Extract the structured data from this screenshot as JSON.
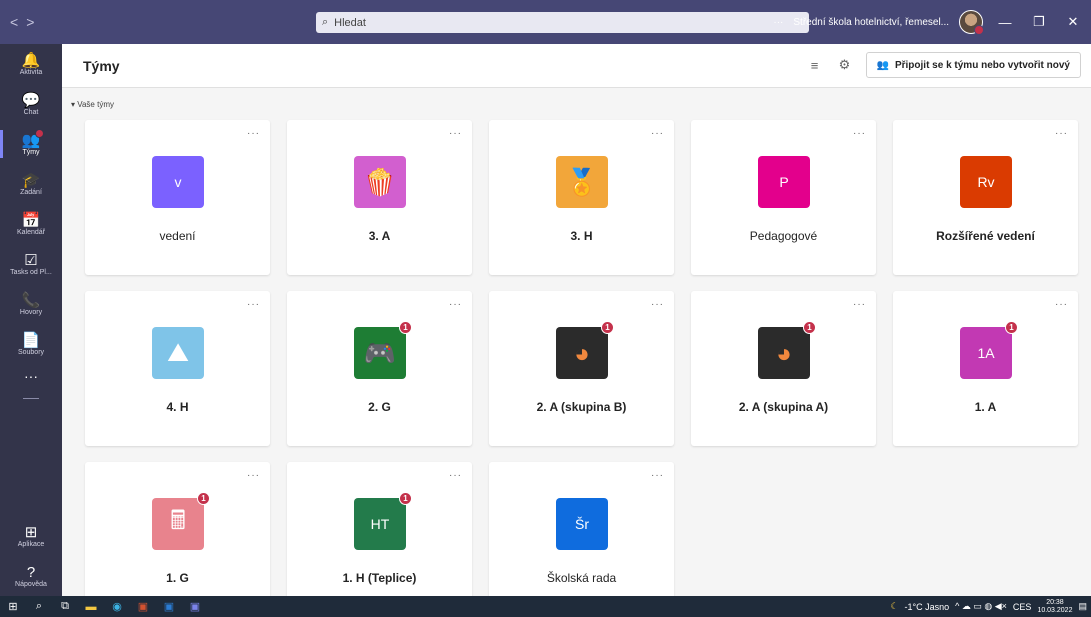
{
  "titlebar": {
    "search_placeholder": "Hledat",
    "more": "···",
    "org_name": "Střední škola hotelnictví, řemesel...",
    "minimize": "—",
    "restore": "❐",
    "close": "✕"
  },
  "rail": {
    "items": [
      {
        "label": "Aktivita",
        "icon": "bell-icon",
        "glyph": "🔔"
      },
      {
        "label": "Chat",
        "icon": "chat-icon",
        "glyph": "💬"
      },
      {
        "label": "Týmy",
        "icon": "teams-icon",
        "glyph": "👥",
        "active": true
      },
      {
        "label": "Zadání",
        "icon": "assignments-icon",
        "glyph": "🎓"
      },
      {
        "label": "Kalendář",
        "icon": "calendar-icon",
        "glyph": "📅"
      },
      {
        "label": "Tasks od Pl...",
        "icon": "tasks-icon",
        "glyph": "☑"
      },
      {
        "label": "Hovory",
        "icon": "phone-icon",
        "glyph": "📞"
      },
      {
        "label": "Soubory",
        "icon": "file-icon",
        "glyph": "📄"
      }
    ],
    "more": "···",
    "bottom": [
      {
        "label": "Aplikace",
        "icon": "apps-icon",
        "glyph": "⊞"
      },
      {
        "label": "Nápověda",
        "icon": "help-icon",
        "glyph": "?"
      }
    ]
  },
  "header": {
    "title": "Týmy",
    "join_label": "Připojit se k týmu nebo vytvořit nový"
  },
  "section": {
    "label": "▾ Vaše týmy"
  },
  "teams": [
    {
      "name": "vedení",
      "tile_text": "v",
      "tile_color": "#7b61ff",
      "bold": false,
      "badge": ""
    },
    {
      "name": "3. A",
      "tile_text": "",
      "tile_color": "#d25fcf",
      "icon": "popcorn-icon",
      "bold": true,
      "badge": ""
    },
    {
      "name": "3. H",
      "tile_text": "",
      "tile_color": "#f2a63a",
      "icon": "medal-icon",
      "bold": true,
      "badge": ""
    },
    {
      "name": "Pedagogové",
      "tile_text": "P",
      "tile_color": "#e3008c",
      "bold": false,
      "badge": ""
    },
    {
      "name": "Rozšířené vedení",
      "tile_text": "Rv",
      "tile_color": "#da3b01",
      "bold": true,
      "badge": ""
    },
    {
      "name": "4. H",
      "tile_text": "",
      "tile_color": "#7fc4e8",
      "icon": "mountain-icon",
      "bold": true,
      "badge": ""
    },
    {
      "name": "2. G",
      "tile_text": "",
      "tile_color": "#1e7d34",
      "icon": "gamepad-icon",
      "bold": true,
      "badge": "1"
    },
    {
      "name": "2. A (skupina B)",
      "tile_text": "",
      "tile_color": "#2b2b2b",
      "icon": "color-wheel-icon",
      "bold": true,
      "badge": "1"
    },
    {
      "name": "2. A (skupina A)",
      "tile_text": "",
      "tile_color": "#2b2b2b",
      "icon": "color-wheel-icon",
      "bold": true,
      "badge": "1"
    },
    {
      "name": "1. A",
      "tile_text": "1A",
      "tile_color": "#c239b3",
      "bold": true,
      "badge": "1"
    },
    {
      "name": "1. G",
      "tile_text": "",
      "tile_color": "#e8838d",
      "icon": "calculator-icon",
      "bold": true,
      "badge": "1"
    },
    {
      "name": "1. H (Teplice)",
      "tile_text": "HT",
      "tile_color": "#237b4b",
      "bold": true,
      "badge": "1"
    },
    {
      "name": "Školská rada",
      "tile_text": "Šr",
      "tile_color": "#0f6cde",
      "bold": false,
      "badge": ""
    }
  ],
  "taskbar": {
    "weather": "-1°C Jasno",
    "lang": "CES",
    "time": "20:38",
    "date": "10.03.2022"
  }
}
